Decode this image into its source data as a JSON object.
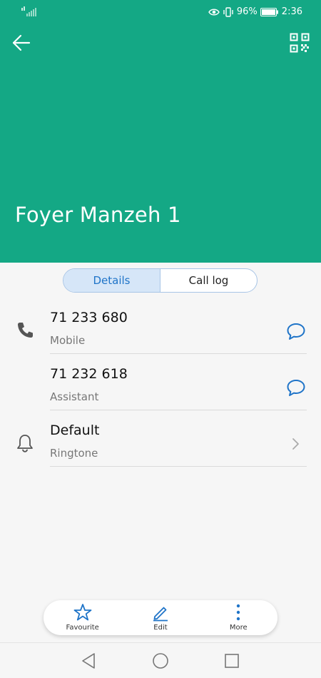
{
  "status_bar": {
    "battery_percent": "96%",
    "time": "2:36"
  },
  "contact": {
    "name": "Foyer Manzeh 1"
  },
  "tabs": [
    {
      "label": "Details",
      "active": true
    },
    {
      "label": "Call log",
      "active": false
    }
  ],
  "phones": [
    {
      "number": "71 233 680",
      "type": "Mobile"
    },
    {
      "number": "71 232 618",
      "type": "Assistant"
    }
  ],
  "ringtone": {
    "value": "Default",
    "label": "Ringtone"
  },
  "bottom_actions": [
    {
      "label": "Favourite",
      "icon": "star-icon"
    },
    {
      "label": "Edit",
      "icon": "pencil-icon"
    },
    {
      "label": "More",
      "icon": "more-vertical-icon"
    }
  ],
  "colors": {
    "header": "#14a885",
    "accent": "#1f74c8"
  }
}
